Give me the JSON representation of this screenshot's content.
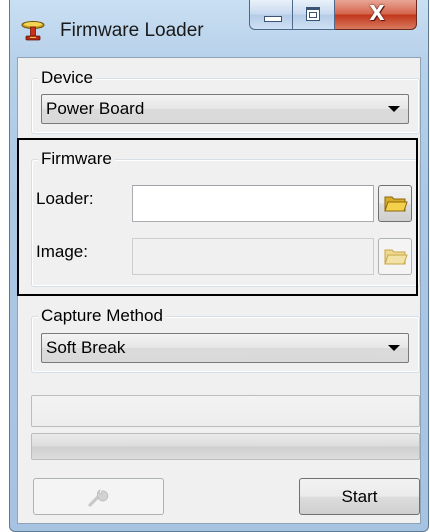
{
  "window": {
    "title": "Firmware Loader",
    "icon": "firmware-loader-app-icon",
    "caption_buttons": [
      "minimize",
      "maximize",
      "close"
    ],
    "close_glyph": "X"
  },
  "device": {
    "legend": "Device",
    "selected": "Power Board"
  },
  "firmware": {
    "legend": "Firmware",
    "loader_label": "Loader:",
    "loader_value": "",
    "loader_enabled": true,
    "image_label": "Image:",
    "image_value": "",
    "image_enabled": false,
    "browse_icon": "folder-open-icon"
  },
  "capture": {
    "legend": "Capture Method",
    "selected": "Soft Break"
  },
  "status": {
    "text": "",
    "progress": 0
  },
  "buttons": {
    "settings_icon": "wrench-icon",
    "settings_enabled": false,
    "start_label": "Start"
  },
  "colors": {
    "folder_yellow": "#f5d04a",
    "folder_disabled": "#f2e2a6",
    "close_red": "#c2371c",
    "title_accent": "#c9dff2"
  }
}
